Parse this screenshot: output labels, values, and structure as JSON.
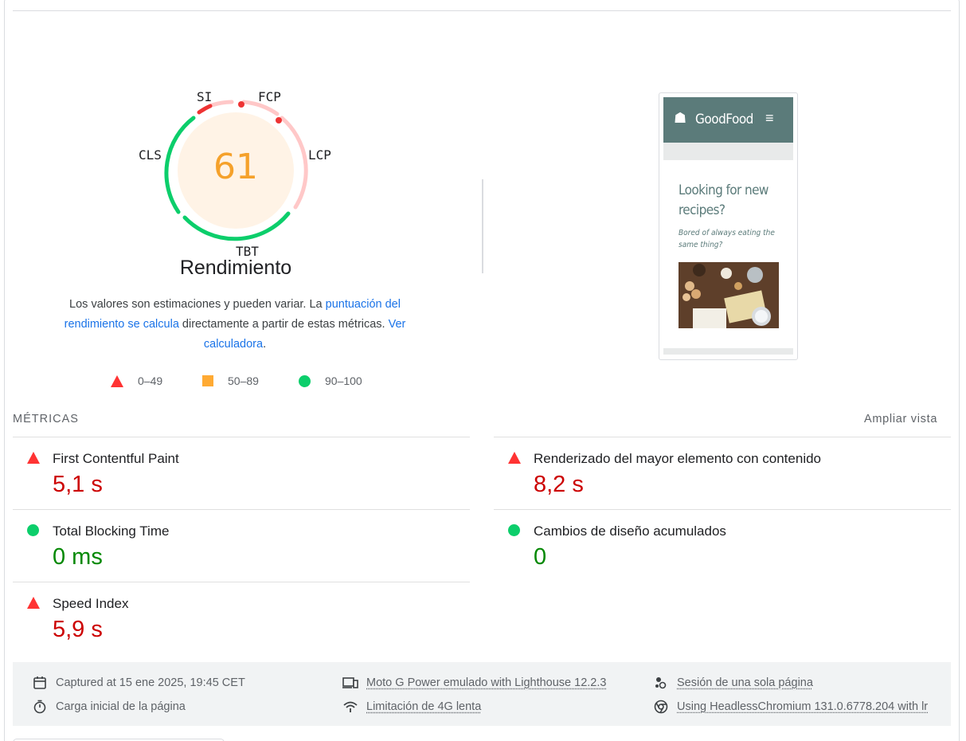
{
  "gauge": {
    "score": "61",
    "title": "Rendimiento",
    "labels": {
      "si": "SI",
      "fcp": "FCP",
      "lcp": "LCP",
      "tbt": "TBT",
      "cls": "CLS"
    }
  },
  "description": {
    "text_before": "Los valores son estimaciones y pueden variar. La ",
    "link1": "puntuación del rendimiento se calcula",
    "text_middle": " directamente a partir de estas métricas. ",
    "link2": "Ver calculadora",
    "text_after": "."
  },
  "legend": [
    {
      "label": "0–49",
      "shape": "triangle",
      "color": "#ff3333"
    },
    {
      "label": "50–89",
      "shape": "square",
      "color": "#ffaa33"
    },
    {
      "label": "90–100",
      "shape": "circle",
      "color": "#0cce6b"
    }
  ],
  "screenshot": {
    "logo": "GoodFood",
    "heading": "Looking for new recipes?",
    "subheading": "Bored of always eating the same thing?"
  },
  "metrics_section": {
    "title": "MÉTRICAS",
    "expand_label": "Ampliar vista"
  },
  "metrics": [
    {
      "name": "First Contentful Paint",
      "value": "5,1 s",
      "status": "poor"
    },
    {
      "name": "Renderizado del mayor elemento con contenido",
      "value": "8,2 s",
      "status": "poor"
    },
    {
      "name": "Total Blocking Time",
      "value": "0 ms",
      "status": "good"
    },
    {
      "name": "Cambios de diseño acumulados",
      "value": "0",
      "status": "good"
    },
    {
      "name": "Speed Index",
      "value": "5,9 s",
      "status": "poor"
    }
  ],
  "info": {
    "captured": "Captured at 15 ene 2025, 19:45 CET",
    "initial_load": "Carga inicial de la página",
    "device": "Moto G Power emulado with Lighthouse 12.2.3",
    "throttling": "Limitación de 4G lenta",
    "session": "Sesión de una sola página",
    "browser": "Using HeadlessChromium 131.0.6778.204 with lr"
  },
  "colors": {
    "poor": "#cc0000",
    "good": "#008800",
    "average": "#f5a12b",
    "link": "#1a73e8"
  }
}
